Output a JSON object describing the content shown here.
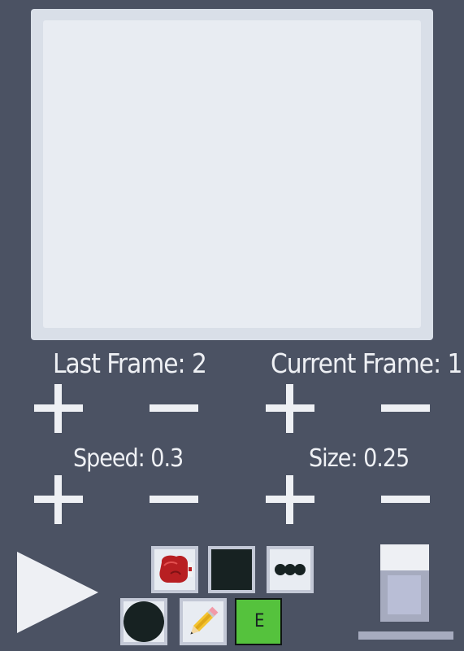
{
  "frames": {
    "last_label": "Last Frame: 2",
    "current_label": "Current Frame: 1"
  },
  "settings": {
    "speed_label": "Speed: 0.3",
    "size_label": "Size: 0.25"
  },
  "tools": {
    "eraser_label": "E",
    "colors": {
      "background": "#4b5263",
      "canvas": "#e8ecf2",
      "ink": "#172222",
      "eraser": "#55c23d"
    },
    "icons": [
      "boxing-glove-icon",
      "color-swatch",
      "dots-brush-icon",
      "circle-brush-icon",
      "pencil-icon",
      "eraser-icon",
      "play-icon",
      "layer-icon"
    ]
  }
}
